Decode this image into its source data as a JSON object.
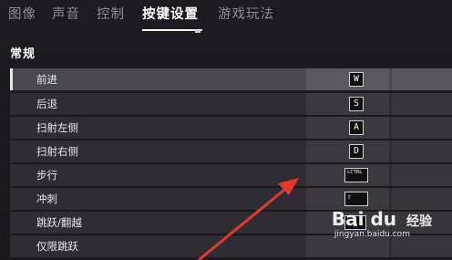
{
  "tabs": [
    "图像",
    "声音",
    "控制",
    "按键设置",
    "游戏玩法"
  ],
  "active_tab": "按键设置",
  "section": {
    "title": "常规"
  },
  "bindings": [
    {
      "label": "前进",
      "key": "W",
      "selected": true
    },
    {
      "label": "后退",
      "key": "S"
    },
    {
      "label": "扫射左侧",
      "key": "A"
    },
    {
      "label": "扫射右侧",
      "key": "D"
    },
    {
      "label": "步行",
      "key": "LCTRL"
    },
    {
      "label": "冲刺",
      "key": "⇧"
    },
    {
      "label": "跳跃/翻越",
      "key": "␣"
    },
    {
      "label": "仅限跳跃",
      "key": ""
    }
  ],
  "watermark": {
    "brand": "Bai  du",
    "cn": "经验",
    "url": "jingyan.baidu.com"
  },
  "colors": {
    "background": "#1e1a22",
    "row": "#2f2c33",
    "row_selected": "#4a4750",
    "arrow": "#e23a2e"
  }
}
